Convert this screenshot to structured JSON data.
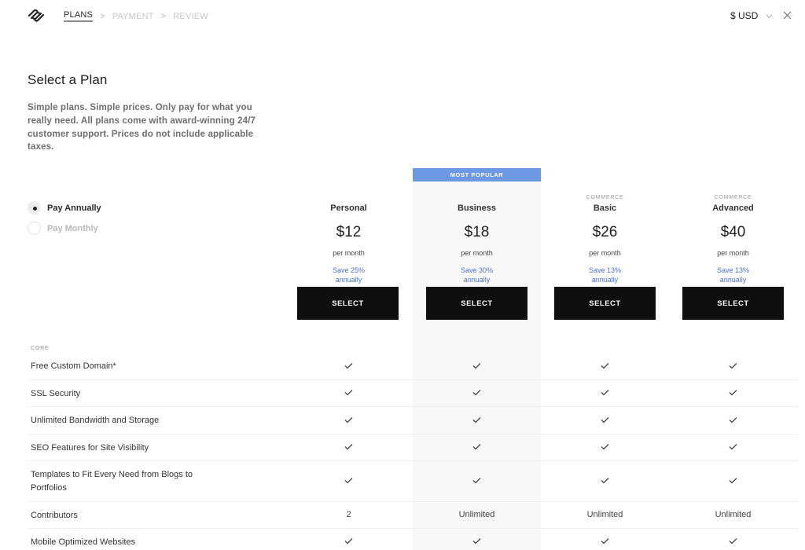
{
  "header": {
    "logo": "squarespace-logo",
    "steps": [
      {
        "label": "PLANS",
        "active": true
      },
      {
        "label": "PAYMENT",
        "active": false
      },
      {
        "label": "REVIEW",
        "active": false
      }
    ],
    "step_separator": ">",
    "currency": "$ USD",
    "currency_icon": "chevron-down-icon",
    "close_icon": "close-icon"
  },
  "intro": {
    "title": "Select a Plan",
    "description": "Simple plans. Simple prices. Only pay for what you really need. All plans come with award-winning 24/7 customer support. Prices do not include applicable taxes."
  },
  "billing": {
    "options": [
      {
        "label": "Pay Annually",
        "selected": true
      },
      {
        "label": "Pay Monthly",
        "selected": false
      }
    ]
  },
  "badge": {
    "label": "MOST POPULAR",
    "color": "#6d98e3"
  },
  "plans": [
    {
      "kicker": "",
      "name": "Personal",
      "price": "$12",
      "period": "per month",
      "save_line1": "Save 25%",
      "save_line2": "annually",
      "button": "SELECT"
    },
    {
      "kicker": "",
      "name": "Business",
      "price": "$18",
      "period": "per month",
      "save_line1": "Save 30%",
      "save_line2": "annually",
      "button": "SELECT",
      "highlighted": true
    },
    {
      "kicker": "COMMERCE",
      "name": "Basic",
      "price": "$26",
      "period": "per month",
      "save_line1": "Save 13%",
      "save_line2": "annually",
      "button": "SELECT"
    },
    {
      "kicker": "COMMERCE",
      "name": "Advanced",
      "price": "$40",
      "period": "per month",
      "save_line1": "Save 13%",
      "save_line2": "annually",
      "button": "SELECT"
    }
  ],
  "features": {
    "section": "CORE",
    "rows": [
      {
        "name": "Free Custom Domain*",
        "values": [
          "check",
          "check",
          "check",
          "check"
        ]
      },
      {
        "name": "SSL Security",
        "values": [
          "check",
          "check",
          "check",
          "check"
        ]
      },
      {
        "name": "Unlimited Bandwidth and Storage",
        "values": [
          "check",
          "check",
          "check",
          "check"
        ]
      },
      {
        "name": "SEO Features for Site Visibility",
        "values": [
          "check",
          "check",
          "check",
          "check"
        ]
      },
      {
        "name": "Templates to Fit Every Need from Blogs to Portfolios",
        "values": [
          "check",
          "check",
          "check",
          "check"
        ]
      },
      {
        "name": "Contributors",
        "values": [
          "2",
          "Unlimited",
          "Unlimited",
          "Unlimited"
        ]
      },
      {
        "name": "Mobile Optimized Websites",
        "values": [
          "check",
          "check",
          "check",
          "check"
        ]
      }
    ]
  },
  "colors": {
    "accent_blue": "#6d98e3",
    "save_text": "#4a72c9",
    "button_bg": "#0f0f0f",
    "highlight_bg": "#f8f8f8"
  }
}
